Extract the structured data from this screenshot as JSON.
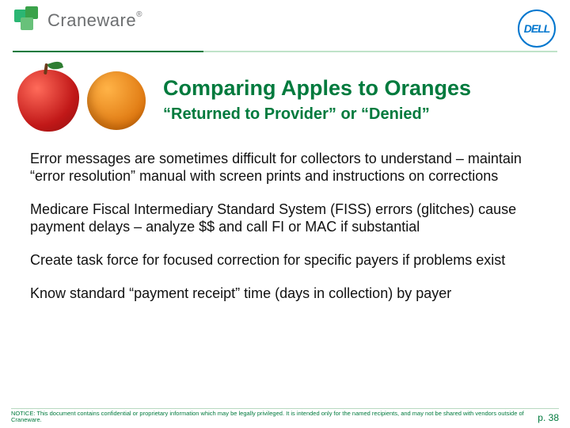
{
  "header": {
    "brand_name": "Craneware",
    "brand_reg": "®",
    "partner_logo_text": "DELL"
  },
  "slide": {
    "title": "Comparing Apples to Oranges",
    "subtitle": "“Returned to Provider” or “Denied”",
    "paragraphs": [
      "Error messages are sometimes difficult for collectors to understand – maintain “error resolution” manual with screen prints and instructions on corrections",
      "Medicare Fiscal Intermediary Standard System (FISS) errors (glitches) cause payment delays – analyze $$ and call FI or MAC if substantial",
      "Create task force for focused correction for specific payers if problems exist",
      "Know standard “payment receipt” time (days in collection) by payer"
    ]
  },
  "footer": {
    "notice": "NOTICE: This document contains confidential or proprietary information which may be legally privileged. It is intended only for the named recipients, and may not be shared with vendors outside of Craneware.",
    "page": "p. 38"
  }
}
